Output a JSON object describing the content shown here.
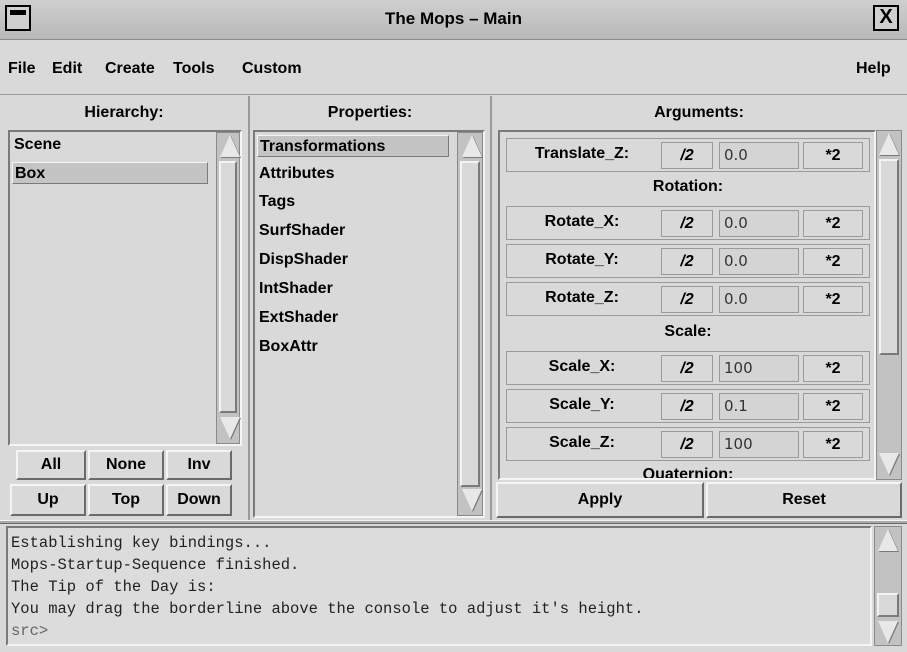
{
  "window": {
    "title": "The Mops – Main",
    "close_glyph": "X"
  },
  "menubar": {
    "items": [
      "File",
      "Edit",
      "Create",
      "Tools",
      "Custom"
    ],
    "help": "Help"
  },
  "hierarchy": {
    "header": "Hierarchy:",
    "items": [
      "Scene",
      "Box"
    ],
    "selected": "Box",
    "buttons": [
      "All",
      "None",
      "Inv",
      "Up",
      "Top",
      "Down"
    ]
  },
  "properties": {
    "header": "Properties:",
    "items": [
      "Transformations",
      "Attributes",
      "Tags",
      "SurfShader",
      "DispShader",
      "IntShader",
      "ExtShader",
      "BoxAttr"
    ],
    "selected": "Transformations"
  },
  "arguments": {
    "header": "Arguments:",
    "rows": [
      {
        "label": "Translate_Z:",
        "div": "/2",
        "value": "0.0",
        "mul": "*2"
      },
      {
        "label": "Rotate_X:",
        "div": "/2",
        "value": "0.0",
        "mul": "*2"
      },
      {
        "label": "Rotate_Y:",
        "div": "/2",
        "value": "0.0",
        "mul": "*2"
      },
      {
        "label": "Rotate_Z:",
        "div": "/2",
        "value": "0.0",
        "mul": "*2"
      },
      {
        "label": "Scale_X:",
        "div": "/2",
        "value": "100",
        "mul": "*2"
      },
      {
        "label": "Scale_Y:",
        "div": "/2",
        "value": "0.1",
        "mul": "*2"
      },
      {
        "label": "Scale_Z:",
        "div": "/2",
        "value": "100",
        "mul": "*2"
      }
    ],
    "sections": [
      "Rotation:",
      "Scale:",
      "Quaternion:"
    ],
    "apply": "Apply",
    "reset": "Reset"
  },
  "console": {
    "lines": [
      "Establishing key bindings...",
      "Mops-Startup-Sequence finished.",
      "The Tip of the Day is:",
      "You may drag the borderline above the console to adjust it's height.",
      "src>"
    ]
  },
  "icons": {
    "window-menu": "window-menu-icon",
    "close": "close-icon",
    "scroll-up": "arrow-up-icon",
    "scroll-down": "arrow-down-icon"
  },
  "colors": {
    "background": "#d9d9d9",
    "selection": "#c4c4c4",
    "titlebar": "#c8c8c8"
  }
}
